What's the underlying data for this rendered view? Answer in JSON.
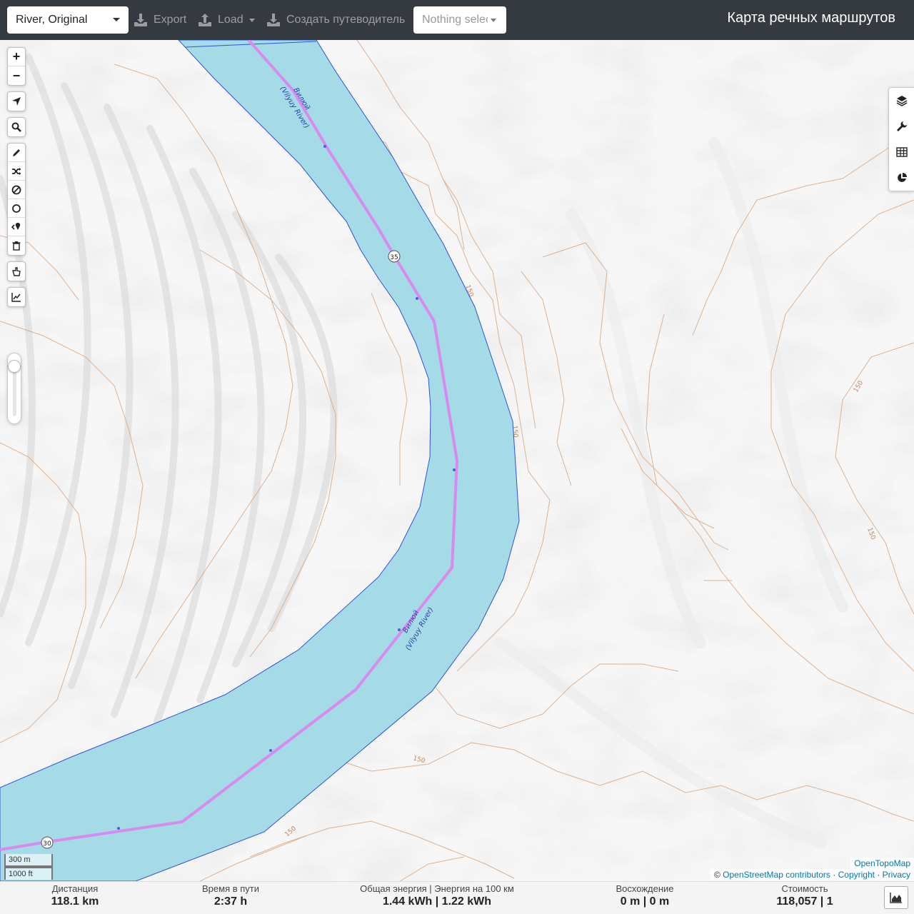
{
  "topbar": {
    "profile_select": "River, Original",
    "export_label": "Export",
    "load_label": "Load",
    "guide_label": "Создать путеводитель",
    "selection_placeholder": "Nothing selected",
    "app_title": "Карта речных маршрутов"
  },
  "map": {
    "river_labels": [
      {
        "name_ru": "Вилюй",
        "name_en": "(Vilyuy River)"
      },
      {
        "name_ru": "Вилюй",
        "name_en": "(Vilyuy River)"
      }
    ],
    "waypoint_markers": [
      "35",
      "30"
    ],
    "contour_labels": [
      "150",
      "150",
      "150",
      "150",
      "150",
      "150"
    ],
    "left_controls": {
      "zoom_in": "+",
      "zoom_out": "−",
      "icons": [
        "locate-icon",
        "search-icon",
        "pencil-icon",
        "shuffle-icon",
        "no-entry-icon",
        "circle-icon",
        "poi-icon",
        "trash-icon",
        "hand-pointer-icon",
        "elevation-chart-icon"
      ]
    },
    "right_controls": [
      "layers-icon",
      "wrench-icon",
      "table-icon",
      "pie-chart-icon"
    ],
    "opacity_slider": {
      "value": 0.9
    },
    "scale": {
      "metric": "300 m",
      "imperial": "1000 ft"
    },
    "attribution": {
      "tiles": "OpenTopoMap",
      "prefix": "©",
      "osm": "OpenStreetMap contributors",
      "copyright": "Copyright",
      "privacy": "Privacy",
      "sep": "·"
    },
    "colors": {
      "water": "#a5dbe7",
      "route": "#d78bee",
      "water_outline": "#2f53d6",
      "contour": "#d8a27a"
    }
  },
  "summary": {
    "distance": {
      "label": "Дистанция",
      "value": "118.1 km"
    },
    "travel_time": {
      "label": "Время в пути",
      "value": "2:37 h"
    },
    "energy": {
      "label": "Общая энергия | Энергия на 100 км",
      "value": "1.44 kWh | 1.22 kWh"
    },
    "ascent": {
      "label": "Восхождение",
      "value": "0 m | 0 m"
    },
    "cost": {
      "label": "Стоимость",
      "value": "118,057 | 1"
    }
  }
}
